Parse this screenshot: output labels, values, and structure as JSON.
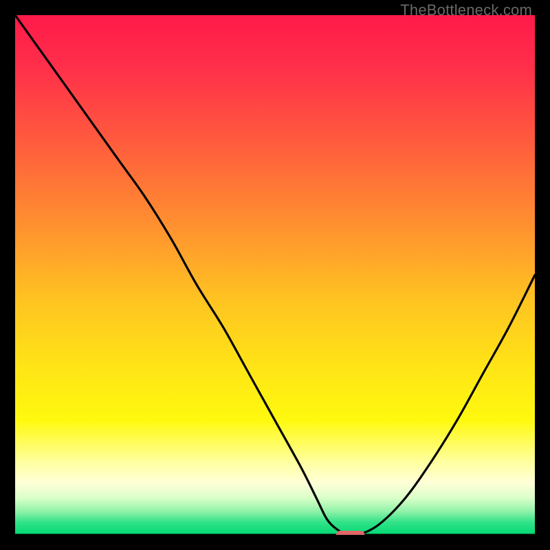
{
  "watermark": "TheBottleneck.com",
  "chart_data": {
    "type": "line",
    "title": "",
    "xlabel": "",
    "ylabel": "",
    "xlim": [
      0,
      100
    ],
    "ylim": [
      0,
      100
    ],
    "grid": false,
    "legend": false,
    "background_gradient": {
      "stops": [
        {
          "pos": 0.0,
          "color": "#ff1a4a"
        },
        {
          "pos": 0.1,
          "color": "#ff2f4a"
        },
        {
          "pos": 0.24,
          "color": "#ff5a3e"
        },
        {
          "pos": 0.4,
          "color": "#ff8f30"
        },
        {
          "pos": 0.55,
          "color": "#ffc421"
        },
        {
          "pos": 0.68,
          "color": "#ffe516"
        },
        {
          "pos": 0.78,
          "color": "#fff90f"
        },
        {
          "pos": 0.86,
          "color": "#ffffa0"
        },
        {
          "pos": 0.9,
          "color": "#ffffd8"
        },
        {
          "pos": 0.93,
          "color": "#d8ffc8"
        },
        {
          "pos": 0.955,
          "color": "#8ff2a8"
        },
        {
          "pos": 0.975,
          "color": "#34e389"
        },
        {
          "pos": 1.0,
          "color": "#00d873"
        }
      ]
    },
    "series": [
      {
        "name": "bottleneck-curve",
        "x": [
          0,
          5,
          10,
          15,
          20,
          25,
          30,
          35,
          40,
          45,
          50,
          55,
          58,
          60,
          62,
          64,
          66,
          70,
          75,
          80,
          85,
          90,
          95,
          100
        ],
        "y": [
          100,
          93,
          86,
          79,
          72,
          65,
          57,
          48,
          40,
          31,
          22,
          13,
          7,
          3,
          1,
          0,
          0,
          2,
          7,
          14,
          22,
          31,
          40,
          50
        ]
      }
    ],
    "marker": {
      "name": "optimal-point",
      "x": 64.5,
      "y": 0,
      "color": "#e06767",
      "width": 5.5,
      "height": 1.6
    }
  }
}
